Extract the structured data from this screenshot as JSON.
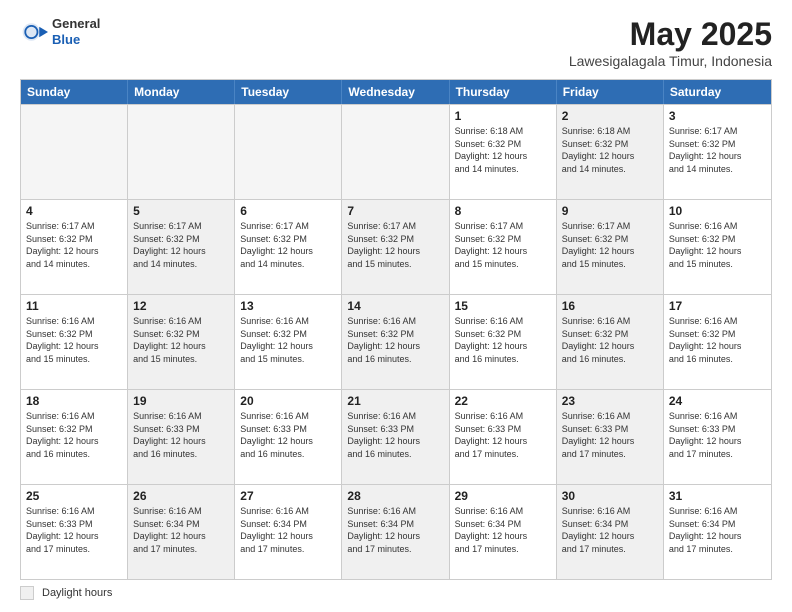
{
  "header": {
    "logo_general": "General",
    "logo_blue": "Blue",
    "title": "May 2025",
    "subtitle": "Lawesigalagala Timur, Indonesia"
  },
  "days_of_week": [
    "Sunday",
    "Monday",
    "Tuesday",
    "Wednesday",
    "Thursday",
    "Friday",
    "Saturday"
  ],
  "weeks": [
    [
      {
        "num": "",
        "detail": "",
        "empty": true
      },
      {
        "num": "",
        "detail": "",
        "empty": true
      },
      {
        "num": "",
        "detail": "",
        "empty": true
      },
      {
        "num": "",
        "detail": "",
        "empty": true
      },
      {
        "num": "1",
        "detail": "Sunrise: 6:18 AM\nSunset: 6:32 PM\nDaylight: 12 hours\nand 14 minutes.",
        "empty": false
      },
      {
        "num": "2",
        "detail": "Sunrise: 6:18 AM\nSunset: 6:32 PM\nDaylight: 12 hours\nand 14 minutes.",
        "empty": false,
        "shaded": true
      },
      {
        "num": "3",
        "detail": "Sunrise: 6:17 AM\nSunset: 6:32 PM\nDaylight: 12 hours\nand 14 minutes.",
        "empty": false
      }
    ],
    [
      {
        "num": "4",
        "detail": "Sunrise: 6:17 AM\nSunset: 6:32 PM\nDaylight: 12 hours\nand 14 minutes.",
        "empty": false
      },
      {
        "num": "5",
        "detail": "Sunrise: 6:17 AM\nSunset: 6:32 PM\nDaylight: 12 hours\nand 14 minutes.",
        "empty": false,
        "shaded": true
      },
      {
        "num": "6",
        "detail": "Sunrise: 6:17 AM\nSunset: 6:32 PM\nDaylight: 12 hours\nand 14 minutes.",
        "empty": false
      },
      {
        "num": "7",
        "detail": "Sunrise: 6:17 AM\nSunset: 6:32 PM\nDaylight: 12 hours\nand 15 minutes.",
        "empty": false,
        "shaded": true
      },
      {
        "num": "8",
        "detail": "Sunrise: 6:17 AM\nSunset: 6:32 PM\nDaylight: 12 hours\nand 15 minutes.",
        "empty": false
      },
      {
        "num": "9",
        "detail": "Sunrise: 6:17 AM\nSunset: 6:32 PM\nDaylight: 12 hours\nand 15 minutes.",
        "empty": false,
        "shaded": true
      },
      {
        "num": "10",
        "detail": "Sunrise: 6:16 AM\nSunset: 6:32 PM\nDaylight: 12 hours\nand 15 minutes.",
        "empty": false
      }
    ],
    [
      {
        "num": "11",
        "detail": "Sunrise: 6:16 AM\nSunset: 6:32 PM\nDaylight: 12 hours\nand 15 minutes.",
        "empty": false
      },
      {
        "num": "12",
        "detail": "Sunrise: 6:16 AM\nSunset: 6:32 PM\nDaylight: 12 hours\nand 15 minutes.",
        "empty": false,
        "shaded": true
      },
      {
        "num": "13",
        "detail": "Sunrise: 6:16 AM\nSunset: 6:32 PM\nDaylight: 12 hours\nand 15 minutes.",
        "empty": false
      },
      {
        "num": "14",
        "detail": "Sunrise: 6:16 AM\nSunset: 6:32 PM\nDaylight: 12 hours\nand 16 minutes.",
        "empty": false,
        "shaded": true
      },
      {
        "num": "15",
        "detail": "Sunrise: 6:16 AM\nSunset: 6:32 PM\nDaylight: 12 hours\nand 16 minutes.",
        "empty": false
      },
      {
        "num": "16",
        "detail": "Sunrise: 6:16 AM\nSunset: 6:32 PM\nDaylight: 12 hours\nand 16 minutes.",
        "empty": false,
        "shaded": true
      },
      {
        "num": "17",
        "detail": "Sunrise: 6:16 AM\nSunset: 6:32 PM\nDaylight: 12 hours\nand 16 minutes.",
        "empty": false
      }
    ],
    [
      {
        "num": "18",
        "detail": "Sunrise: 6:16 AM\nSunset: 6:32 PM\nDaylight: 12 hours\nand 16 minutes.",
        "empty": false
      },
      {
        "num": "19",
        "detail": "Sunrise: 6:16 AM\nSunset: 6:33 PM\nDaylight: 12 hours\nand 16 minutes.",
        "empty": false,
        "shaded": true
      },
      {
        "num": "20",
        "detail": "Sunrise: 6:16 AM\nSunset: 6:33 PM\nDaylight: 12 hours\nand 16 minutes.",
        "empty": false
      },
      {
        "num": "21",
        "detail": "Sunrise: 6:16 AM\nSunset: 6:33 PM\nDaylight: 12 hours\nand 16 minutes.",
        "empty": false,
        "shaded": true
      },
      {
        "num": "22",
        "detail": "Sunrise: 6:16 AM\nSunset: 6:33 PM\nDaylight: 12 hours\nand 17 minutes.",
        "empty": false
      },
      {
        "num": "23",
        "detail": "Sunrise: 6:16 AM\nSunset: 6:33 PM\nDaylight: 12 hours\nand 17 minutes.",
        "empty": false,
        "shaded": true
      },
      {
        "num": "24",
        "detail": "Sunrise: 6:16 AM\nSunset: 6:33 PM\nDaylight: 12 hours\nand 17 minutes.",
        "empty": false
      }
    ],
    [
      {
        "num": "25",
        "detail": "Sunrise: 6:16 AM\nSunset: 6:33 PM\nDaylight: 12 hours\nand 17 minutes.",
        "empty": false
      },
      {
        "num": "26",
        "detail": "Sunrise: 6:16 AM\nSunset: 6:34 PM\nDaylight: 12 hours\nand 17 minutes.",
        "empty": false,
        "shaded": true
      },
      {
        "num": "27",
        "detail": "Sunrise: 6:16 AM\nSunset: 6:34 PM\nDaylight: 12 hours\nand 17 minutes.",
        "empty": false
      },
      {
        "num": "28",
        "detail": "Sunrise: 6:16 AM\nSunset: 6:34 PM\nDaylight: 12 hours\nand 17 minutes.",
        "empty": false,
        "shaded": true
      },
      {
        "num": "29",
        "detail": "Sunrise: 6:16 AM\nSunset: 6:34 PM\nDaylight: 12 hours\nand 17 minutes.",
        "empty": false
      },
      {
        "num": "30",
        "detail": "Sunrise: 6:16 AM\nSunset: 6:34 PM\nDaylight: 12 hours\nand 17 minutes.",
        "empty": false,
        "shaded": true
      },
      {
        "num": "31",
        "detail": "Sunrise: 6:16 AM\nSunset: 6:34 PM\nDaylight: 12 hours\nand 17 minutes.",
        "empty": false
      }
    ]
  ],
  "legend": {
    "box_label": "Daylight hours"
  }
}
